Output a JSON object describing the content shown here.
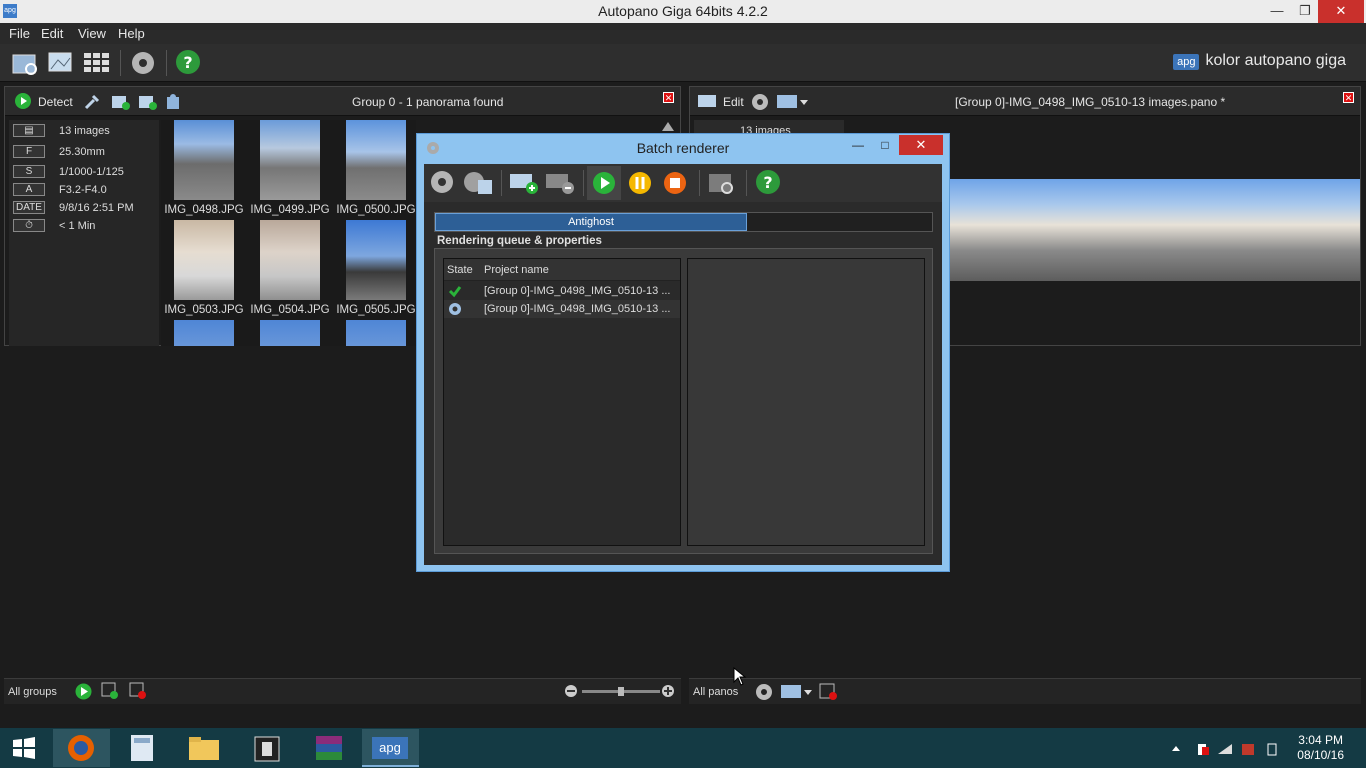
{
  "window": {
    "title": "Autopano Giga 64bits 4.2.2",
    "app_icon_text": "apg"
  },
  "menu": [
    "File",
    "Edit",
    "View",
    "Help"
  ],
  "brand": {
    "badge": "apg",
    "text": "kolor autopano giga"
  },
  "left_panel": {
    "detect_label": "Detect",
    "title": "Group 0 - 1 panorama found",
    "info": [
      {
        "key": "▤",
        "value": "13 images"
      },
      {
        "key": "F",
        "value": "25.30mm"
      },
      {
        "key": "S",
        "value": "1/1000-1/125"
      },
      {
        "key": "A",
        "value": "F3.2-F4.0"
      },
      {
        "key": "DATE",
        "value": "9/8/16 2:51 PM"
      },
      {
        "key": "⏱",
        "value": "< 1 Min"
      }
    ],
    "thumbnails": [
      "IMG_0498.JPG",
      "IMG_0499.JPG",
      "IMG_0500.JPG",
      "IMG_0503.JPG",
      "IMG_0504.JPG",
      "IMG_0505.JPG"
    ],
    "bottom_label": "All groups"
  },
  "right_panel": {
    "edit_label": "Edit",
    "title": "[Group 0]-IMG_0498_IMG_0510-13 images.pano *",
    "count_label": "13 images",
    "bottom_label": "All panos"
  },
  "dialog": {
    "title": "Batch renderer",
    "tab": "Antighost",
    "section": "Rendering queue & properties",
    "columns": [
      "State",
      "Project name"
    ],
    "rows": [
      {
        "state": "done",
        "name": "[Group 0]-IMG_0498_IMG_0510-13 ..."
      },
      {
        "state": "rendering",
        "name": "[Group 0]-IMG_0498_IMG_0510-13 ..."
      }
    ]
  },
  "taskbar": {
    "time": "3:04 PM",
    "date": "08/10/16"
  },
  "colors": {
    "accent": "#3b74b9",
    "dialog_border": "#8ec4f0",
    "play": "#2ab33a",
    "pause": "#f5b800",
    "stop": "#ec6412"
  }
}
